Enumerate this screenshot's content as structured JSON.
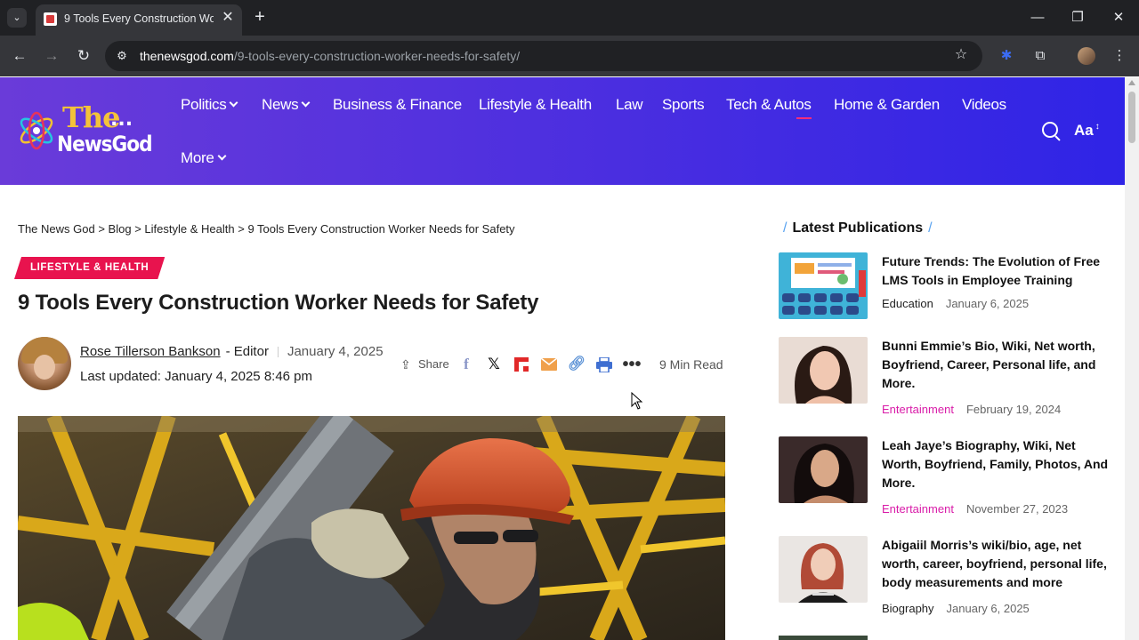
{
  "browser": {
    "tab_title": "9 Tools Every Construction Worker Needs for Safety",
    "url_host": "thenewsgod.com",
    "url_path": "/9-tools-every-construction-worker-needs-for-safety/"
  },
  "site": {
    "logo_the": "The",
    "logo_dots": "...",
    "logo_name": "NewsGod",
    "nav": [
      {
        "label": "Politics"
      },
      {
        "label": "News"
      },
      {
        "label": "Business & Finance"
      },
      {
        "label": "Lifestyle & Health"
      },
      {
        "label": "Law"
      },
      {
        "label": "Sports"
      },
      {
        "label": "Tech & Autos"
      },
      {
        "label": "Home & Garden"
      },
      {
        "label": "Videos"
      },
      {
        "label": "More"
      }
    ],
    "font_size_label": "Aa"
  },
  "breadcrumb": {
    "items": [
      "The News God",
      "Blog",
      "Lifestyle & Health",
      "9 Tools Every Construction Worker Needs for Safety"
    ],
    "separator": ">"
  },
  "article": {
    "category": "LIFESTYLE & HEALTH",
    "title": "9 Tools Every Construction Worker Needs for Safety",
    "author": "Rose Tillerson Bankson",
    "author_role": "- Editor",
    "date": "January 4, 2025",
    "updated": "Last updated: January 4, 2025 8:46 pm",
    "share_label": "Share",
    "read_time": "9 Min Read"
  },
  "sidebar": {
    "title": "Latest Publications",
    "items": [
      {
        "title": "Future Trends: The Evolution of Free LMS Tools in Employee Training",
        "category": "Education",
        "date": "January 6, 2025"
      },
      {
        "title": "Bunni Emmie’s Bio, Wiki, Net worth, Boyfriend, Career, Personal life, and More.",
        "category": "Entertainment",
        "date": "February 19, 2024"
      },
      {
        "title": "Leah Jaye’s Biography, Wiki, Net Worth, Boyfriend, Family, Photos, And More.",
        "category": "Entertainment",
        "date": "November 27, 2023"
      },
      {
        "title": "Abigaiil Morris’s wiki/bio, age, net worth, career, boyfriend, personal life, body measurements and more",
        "category": "Biography",
        "date": "January 6, 2025"
      }
    ]
  },
  "colors": {
    "header_start": "#6a3bd9",
    "header_end": "#2f24e6",
    "badge": "#e8134e",
    "accent_category": "#d91ba8"
  }
}
